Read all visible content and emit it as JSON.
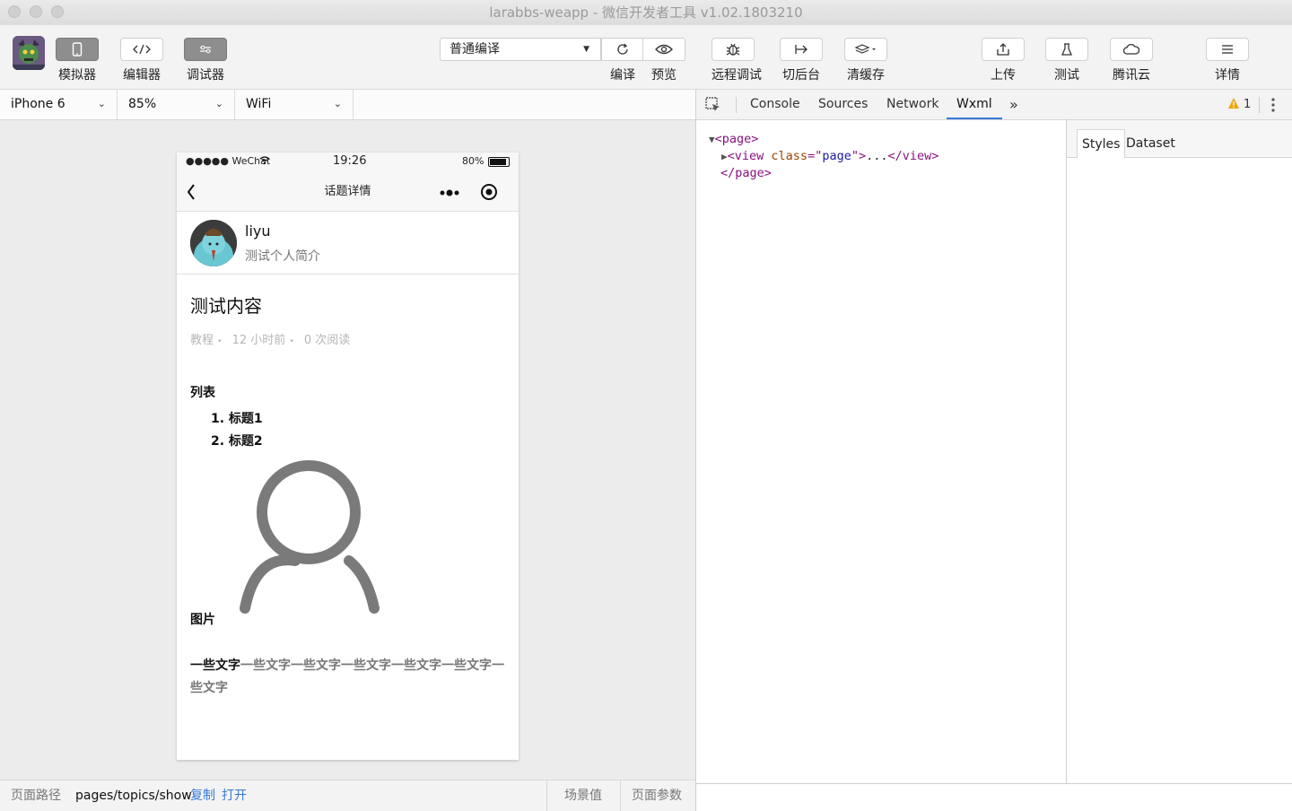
{
  "window": {
    "title": "larabbs-weapp - 微信开发者工具 v1.02.1803210"
  },
  "toolbar": {
    "simulator": "模拟器",
    "editor": "编辑器",
    "debugger": "调试器",
    "compile_mode": "普通编译",
    "compile": "编译",
    "preview": "预览",
    "remote_debug": "远程调试",
    "background": "切后台",
    "clear_cache": "清缓存",
    "upload": "上传",
    "test": "测试",
    "tencent_cloud": "腾讯云",
    "details": "详情"
  },
  "device": {
    "model": "iPhone 6",
    "zoom": "85%",
    "network": "WiFi"
  },
  "phone": {
    "status": {
      "carrier": "●●●●● WeChat",
      "time": "19:26",
      "battery": "80%",
      "battery_level": 0.8
    },
    "nav_title": "话题详情",
    "user": {
      "name": "liyu",
      "bio": "测试个人简介"
    },
    "topic": {
      "title": "测试内容",
      "category": "教程",
      "time_ago": "12 小时前",
      "views": "0 次阅读",
      "meta_sep": "•"
    },
    "body": {
      "list_heading": "列表",
      "list_items": [
        "1. 标题1",
        "2. 标题2"
      ],
      "image_heading": "图片",
      "text_bold": "一些文字",
      "text_rest": "一些文字一些文字一些文字一些文字一些文字一些文字"
    }
  },
  "pathbar": {
    "label": "页面路径",
    "path": "pages/topics/show",
    "copy": "复制",
    "open": "打开",
    "scene": "场景值",
    "params": "页面参数"
  },
  "devtools": {
    "tabs": [
      "Console",
      "Sources",
      "Network",
      "Wxml"
    ],
    "active_tab": "Wxml",
    "more": "»",
    "warnings": "1",
    "side_tabs": [
      "Styles",
      "Dataset"
    ],
    "wxml": {
      "line1_tag": "page",
      "line2_tag": "view",
      "line2_attr": "class",
      "line2_val": "page",
      "line2_ellipsis": "...",
      "line3_tag": "page"
    }
  },
  "colors": {
    "link": "#3879d9",
    "active_btn": "#8e8e8e",
    "warning": "#f0a30a"
  }
}
